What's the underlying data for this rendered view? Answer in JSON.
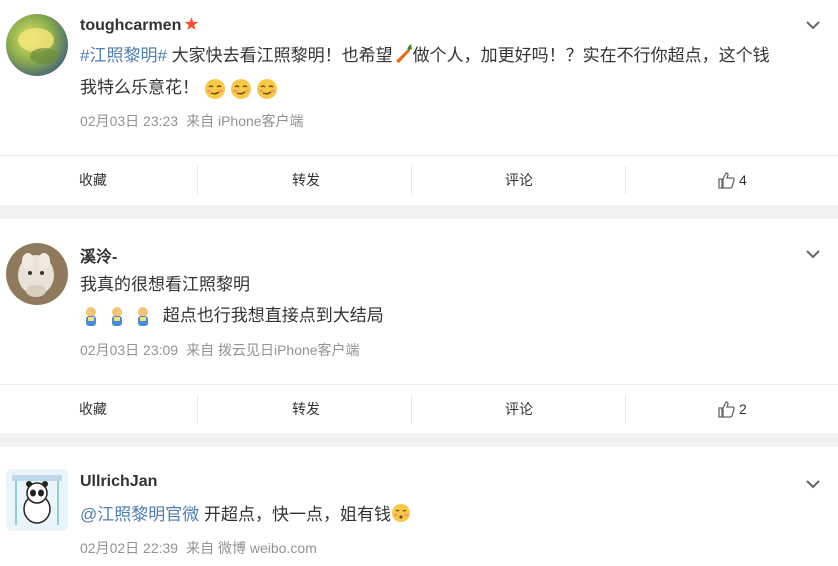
{
  "posts": [
    {
      "username": "toughcarmen",
      "has_star": true,
      "text_topic": "#江照黎明#",
      "text_part1": " 大家快去看江照黎明！也希望",
      "text_part2": "做个人，加更好吗！？实在不行你超点，这个钱",
      "text_line2": "我特么乐意花！",
      "date": "02月03日 23:23",
      "source": "来自 iPhone客户端",
      "actions": {
        "collect": "收藏",
        "forward": "转发",
        "comment": "评论",
        "like_count": "4"
      }
    },
    {
      "username": "溪泠-",
      "text_line1": "我真的很想看江照黎明",
      "text_line2": "超点也行我想直接点到大结局",
      "date": "02月03日 23:09",
      "source": "来自 拨云见日iPhone客户端",
      "actions": {
        "collect": "收藏",
        "forward": "转发",
        "comment": "评论",
        "like_count": "2"
      }
    },
    {
      "username": "UllrichJan",
      "mention": "@江照黎明官微",
      "text_line1": " 开超点，快一点，姐有钱",
      "date": "02月02日 22:39",
      "source": "来自 微博 weibo.com"
    }
  ],
  "colors": {
    "link": "#507daf",
    "meta": "#939393",
    "star": "#ff4d2e"
  }
}
